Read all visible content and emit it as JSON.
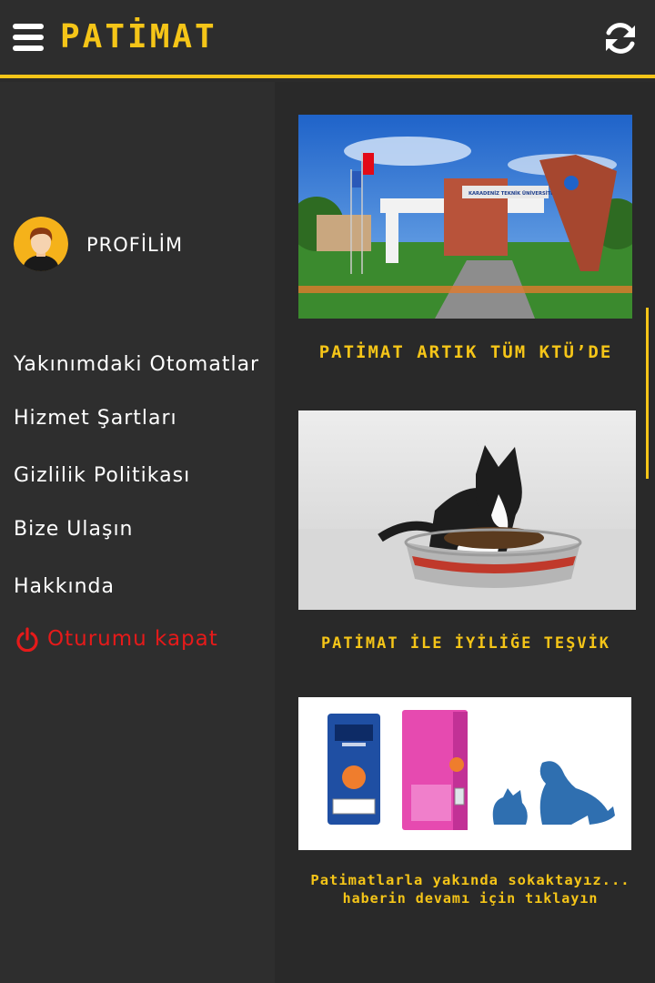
{
  "header": {
    "title": "PATİMAT",
    "menu_icon": "hamburger-menu-icon",
    "refresh_icon": "refresh-icon",
    "accent_color": "#f5c518"
  },
  "drawer": {
    "profile_label": "PROFİLİM",
    "avatar_icon": "user-avatar-icon",
    "items": [
      {
        "label": "Yakınımdaki Otomatlar"
      },
      {
        "label": "Hizmet Şartları"
      },
      {
        "label": "Gizlilik Politikası"
      },
      {
        "label": "Bize Ulaşın"
      },
      {
        "label": "Hakkında"
      }
    ],
    "logout_label": "Oturumu kapat",
    "logout_icon": "power-icon",
    "logout_color": "#e61a1a"
  },
  "feed": {
    "news": [
      {
        "title": "PATİMAT ARTIK TÜM KTÜ’DE",
        "image": "university-gate-image",
        "gate_text": "KARADENİZ TEKNİK ÜNİVERSİTESİ"
      },
      {
        "title": "PATİMAT İLE İYİLİĞE TEŞVİK",
        "image": "kitten-eating-image"
      },
      {
        "title": "Patimatlarla yakında sokaktayız...",
        "subtitle": "haberin devamı için tıklayın",
        "image": "vending-machines-image"
      }
    ]
  }
}
